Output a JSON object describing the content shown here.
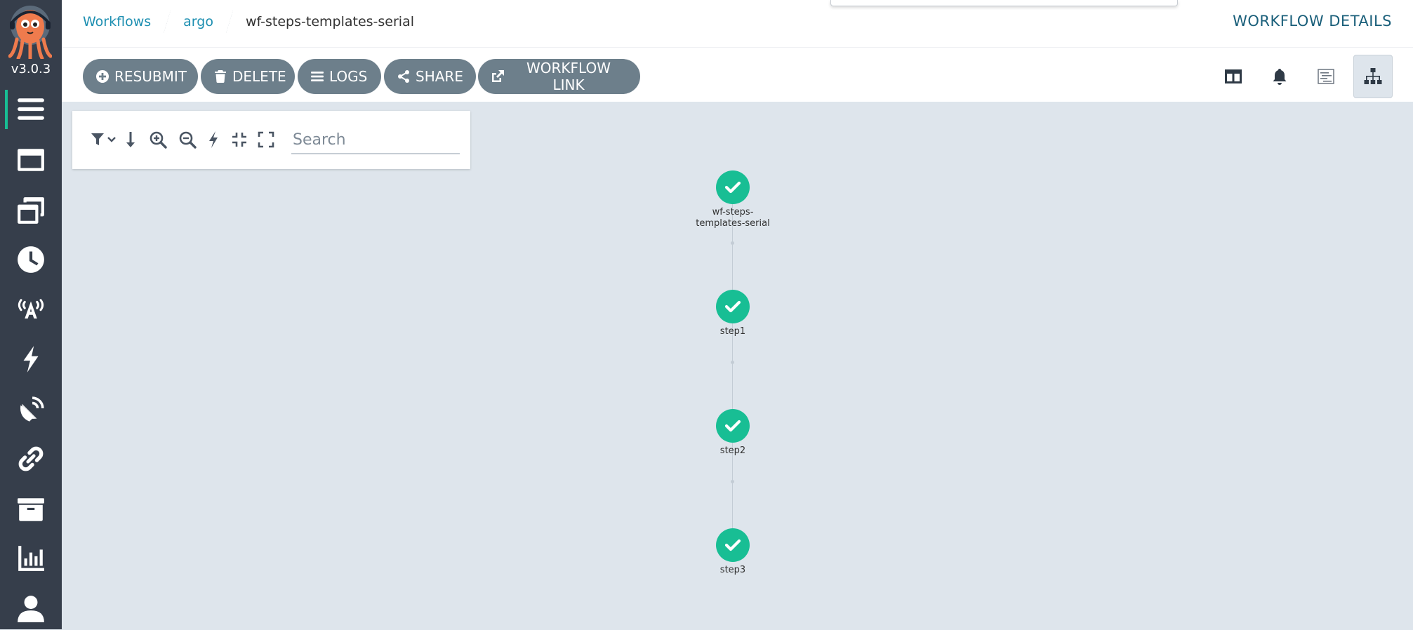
{
  "app": {
    "version": "v3.0.3"
  },
  "breadcrumb": [
    {
      "label": "Workflows"
    },
    {
      "label": "argo"
    },
    {
      "label": "wf-steps-templates-serial"
    }
  ],
  "header": {
    "title": "WORKFLOW DETAILS"
  },
  "toolbar": {
    "resubmit_label": "RESUBMIT",
    "delete_label": "DELETE",
    "logs_label": "LOGS",
    "share_label": "SHARE",
    "workflow_link_label": "WORKFLOW LINK"
  },
  "graph_toolbar": {
    "search_placeholder": "Search"
  },
  "workflow": {
    "nodes": [
      {
        "label_line1": "wf-steps-",
        "label_line2": "templates-serial",
        "status": "succeeded"
      },
      {
        "label_line1": "step1",
        "label_line2": "",
        "status": "succeeded"
      },
      {
        "label_line1": "step2",
        "label_line2": "",
        "status": "succeeded"
      },
      {
        "label_line1": "step3",
        "label_line2": "",
        "status": "succeeded"
      }
    ]
  },
  "colors": {
    "sidebar_bg": "#363e4b",
    "accent": "#18be94",
    "link": "#1d8fb1",
    "button_bg": "#6d7f8b",
    "canvas_bg": "#dee5ec"
  }
}
